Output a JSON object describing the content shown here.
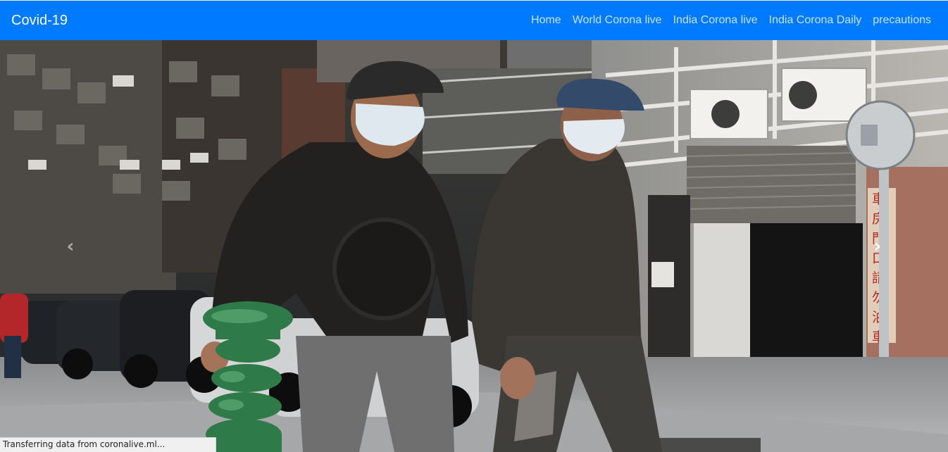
{
  "navbar": {
    "brand": "Covid-19",
    "links": [
      {
        "label": "Home"
      },
      {
        "label": "World Corona live"
      },
      {
        "label": "India Corona live"
      },
      {
        "label": "India Corona Daily"
      },
      {
        "label": "precautions"
      }
    ],
    "color": "#007bff"
  },
  "carousel": {
    "prev_icon": "chevron-left-icon",
    "next_icon": "chevron-right-icon",
    "prev_glyph": "‹",
    "next_glyph": "›",
    "image_alt": "Two men wearing face masks walking on a city street"
  },
  "status_bar": {
    "text": "Transferring data from coronalive.ml..."
  }
}
